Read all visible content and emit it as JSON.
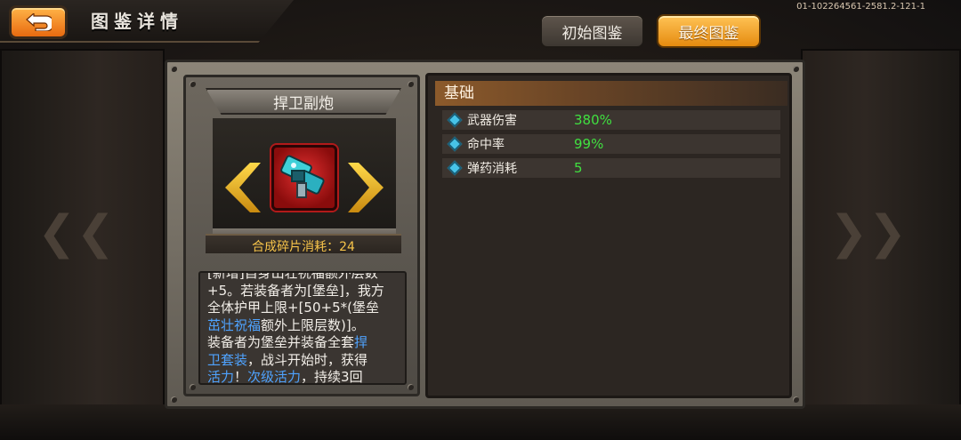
{
  "header": {
    "title": "图鉴详情",
    "version": "01-102264561-2581.2-121-1"
  },
  "tabs": [
    {
      "label": "初始图鉴",
      "active": false
    },
    {
      "label": "最终图鉴",
      "active": true
    }
  ],
  "item": {
    "name": "捍卫副炮",
    "shard_cost_label": "合成碎片消耗：24"
  },
  "description": {
    "line1": "[新增]自身出壮祝福额外层数",
    "line2": "+5。若装备者为[堡垒]，我方",
    "line3": "全体护甲上限+[50+5*(堡垒",
    "line4_hl": "茁壮祝福",
    "line4_rest": "额外上限层数)]。",
    "line5_a": "装备者为堡垒并装备全套",
    "line5_hl": "捍",
    "line6_hl": "卫套装",
    "line6_rest": "，战斗开始时，获得",
    "line7_hl1": "活力",
    "line7_mid": "！",
    "line7_hl2": "次级活力",
    "line7_rest": "，持续3回"
  },
  "stats": {
    "section_title": "基础",
    "rows": [
      {
        "label": "武器伤害",
        "value": "380%"
      },
      {
        "label": "命中率",
        "value": "99%"
      },
      {
        "label": "弹药消耗",
        "value": "5"
      }
    ]
  },
  "colors": {
    "accent_orange": "#e58b0f",
    "stat_value_green": "#40e040",
    "highlight_blue": "#4fa3ff",
    "shard_text_gold": "#f7c44a"
  },
  "icons": {
    "back": "back-arrow-icon",
    "stat": "diamond-icon",
    "item": "cannon-icon"
  }
}
